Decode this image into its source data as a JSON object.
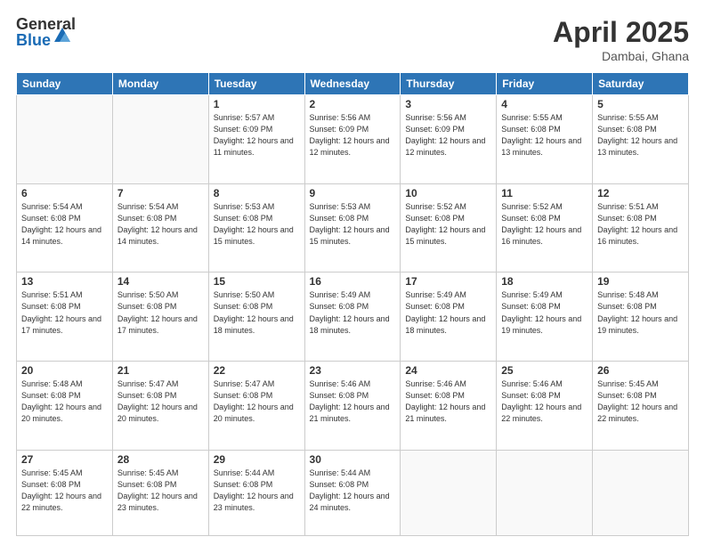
{
  "header": {
    "logo_general": "General",
    "logo_blue": "Blue",
    "month_title": "April 2025",
    "location": "Dambai, Ghana"
  },
  "days_of_week": [
    "Sunday",
    "Monday",
    "Tuesday",
    "Wednesday",
    "Thursday",
    "Friday",
    "Saturday"
  ],
  "weeks": [
    [
      {
        "day": "",
        "info": ""
      },
      {
        "day": "",
        "info": ""
      },
      {
        "day": "1",
        "info": "Sunrise: 5:57 AM\nSunset: 6:09 PM\nDaylight: 12 hours and 11 minutes."
      },
      {
        "day": "2",
        "info": "Sunrise: 5:56 AM\nSunset: 6:09 PM\nDaylight: 12 hours and 12 minutes."
      },
      {
        "day": "3",
        "info": "Sunrise: 5:56 AM\nSunset: 6:09 PM\nDaylight: 12 hours and 12 minutes."
      },
      {
        "day": "4",
        "info": "Sunrise: 5:55 AM\nSunset: 6:08 PM\nDaylight: 12 hours and 13 minutes."
      },
      {
        "day": "5",
        "info": "Sunrise: 5:55 AM\nSunset: 6:08 PM\nDaylight: 12 hours and 13 minutes."
      }
    ],
    [
      {
        "day": "6",
        "info": "Sunrise: 5:54 AM\nSunset: 6:08 PM\nDaylight: 12 hours and 14 minutes."
      },
      {
        "day": "7",
        "info": "Sunrise: 5:54 AM\nSunset: 6:08 PM\nDaylight: 12 hours and 14 minutes."
      },
      {
        "day": "8",
        "info": "Sunrise: 5:53 AM\nSunset: 6:08 PM\nDaylight: 12 hours and 15 minutes."
      },
      {
        "day": "9",
        "info": "Sunrise: 5:53 AM\nSunset: 6:08 PM\nDaylight: 12 hours and 15 minutes."
      },
      {
        "day": "10",
        "info": "Sunrise: 5:52 AM\nSunset: 6:08 PM\nDaylight: 12 hours and 15 minutes."
      },
      {
        "day": "11",
        "info": "Sunrise: 5:52 AM\nSunset: 6:08 PM\nDaylight: 12 hours and 16 minutes."
      },
      {
        "day": "12",
        "info": "Sunrise: 5:51 AM\nSunset: 6:08 PM\nDaylight: 12 hours and 16 minutes."
      }
    ],
    [
      {
        "day": "13",
        "info": "Sunrise: 5:51 AM\nSunset: 6:08 PM\nDaylight: 12 hours and 17 minutes."
      },
      {
        "day": "14",
        "info": "Sunrise: 5:50 AM\nSunset: 6:08 PM\nDaylight: 12 hours and 17 minutes."
      },
      {
        "day": "15",
        "info": "Sunrise: 5:50 AM\nSunset: 6:08 PM\nDaylight: 12 hours and 18 minutes."
      },
      {
        "day": "16",
        "info": "Sunrise: 5:49 AM\nSunset: 6:08 PM\nDaylight: 12 hours and 18 minutes."
      },
      {
        "day": "17",
        "info": "Sunrise: 5:49 AM\nSunset: 6:08 PM\nDaylight: 12 hours and 18 minutes."
      },
      {
        "day": "18",
        "info": "Sunrise: 5:49 AM\nSunset: 6:08 PM\nDaylight: 12 hours and 19 minutes."
      },
      {
        "day": "19",
        "info": "Sunrise: 5:48 AM\nSunset: 6:08 PM\nDaylight: 12 hours and 19 minutes."
      }
    ],
    [
      {
        "day": "20",
        "info": "Sunrise: 5:48 AM\nSunset: 6:08 PM\nDaylight: 12 hours and 20 minutes."
      },
      {
        "day": "21",
        "info": "Sunrise: 5:47 AM\nSunset: 6:08 PM\nDaylight: 12 hours and 20 minutes."
      },
      {
        "day": "22",
        "info": "Sunrise: 5:47 AM\nSunset: 6:08 PM\nDaylight: 12 hours and 20 minutes."
      },
      {
        "day": "23",
        "info": "Sunrise: 5:46 AM\nSunset: 6:08 PM\nDaylight: 12 hours and 21 minutes."
      },
      {
        "day": "24",
        "info": "Sunrise: 5:46 AM\nSunset: 6:08 PM\nDaylight: 12 hours and 21 minutes."
      },
      {
        "day": "25",
        "info": "Sunrise: 5:46 AM\nSunset: 6:08 PM\nDaylight: 12 hours and 22 minutes."
      },
      {
        "day": "26",
        "info": "Sunrise: 5:45 AM\nSunset: 6:08 PM\nDaylight: 12 hours and 22 minutes."
      }
    ],
    [
      {
        "day": "27",
        "info": "Sunrise: 5:45 AM\nSunset: 6:08 PM\nDaylight: 12 hours and 22 minutes."
      },
      {
        "day": "28",
        "info": "Sunrise: 5:45 AM\nSunset: 6:08 PM\nDaylight: 12 hours and 23 minutes."
      },
      {
        "day": "29",
        "info": "Sunrise: 5:44 AM\nSunset: 6:08 PM\nDaylight: 12 hours and 23 minutes."
      },
      {
        "day": "30",
        "info": "Sunrise: 5:44 AM\nSunset: 6:08 PM\nDaylight: 12 hours and 24 minutes."
      },
      {
        "day": "",
        "info": ""
      },
      {
        "day": "",
        "info": ""
      },
      {
        "day": "",
        "info": ""
      }
    ]
  ]
}
